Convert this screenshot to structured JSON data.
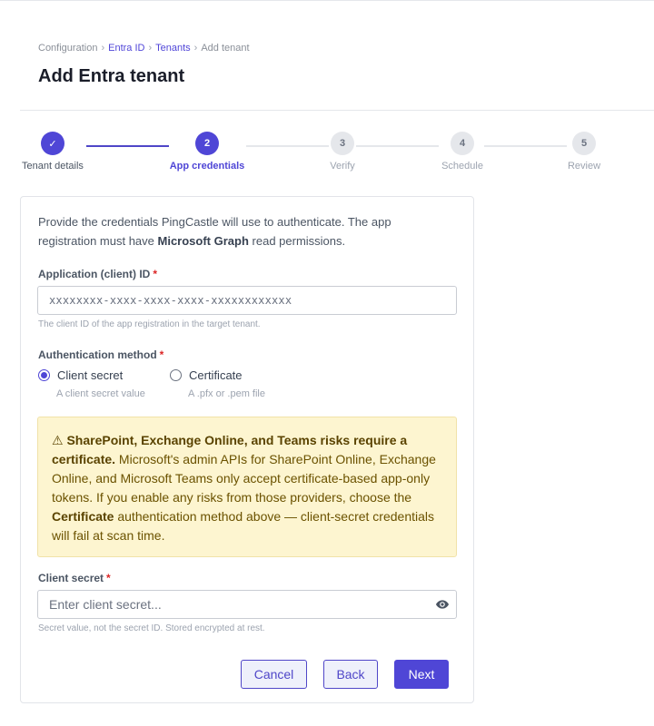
{
  "breadcrumb": {
    "items": [
      "Configuration",
      "Entra ID",
      "Tenants",
      "Add tenant"
    ],
    "separator": "›"
  },
  "page": {
    "title": "Add Entra tenant"
  },
  "stepper": {
    "steps": [
      {
        "number": "✓",
        "label": "Tenant details",
        "state": "done"
      },
      {
        "number": "2",
        "label": "App credentials",
        "state": "active"
      },
      {
        "number": "3",
        "label": "Verify",
        "state": "pending"
      },
      {
        "number": "4",
        "label": "Schedule",
        "state": "pending"
      },
      {
        "number": "5",
        "label": "Review",
        "state": "pending"
      }
    ]
  },
  "form": {
    "intro_part1": "Provide the credentials PingCastle will use to authenticate. The app registration must have ",
    "intro_bold": "Microsoft Graph",
    "intro_part2": " read permissions.",
    "client_id": {
      "label": "Application (client) ID",
      "required_mark": "*",
      "placeholder": "xxxxxxxx-xxxx-xxxx-xxxx-xxxxxxxxxxxx",
      "help": "The client ID of the app registration in the target tenant."
    },
    "auth_method": {
      "label": "Authentication method",
      "required_mark": "*",
      "options": [
        {
          "label": "Client secret",
          "help": "A client secret value",
          "checked": true
        },
        {
          "label": "Certificate",
          "help": "A .pfx or .pem file",
          "checked": false
        }
      ]
    },
    "warning": {
      "icon": "⚠",
      "title": "SharePoint, Exchange Online, and Teams risks require a certificate.",
      "body1": " Microsoft's admin APIs for SharePoint Online, Exchange Online, and Microsoft Teams only accept certificate-based app-only tokens. If you enable any risks from those providers, choose the ",
      "body_bold": "Certificate",
      "body2": " authentication method above — client-secret credentials will fail at scan time."
    },
    "client_secret": {
      "label": "Client secret",
      "required_mark": "*",
      "placeholder": "Enter client secret...",
      "help": "Secret value, not the secret ID. Stored encrypted at rest."
    },
    "buttons": {
      "cancel": "Cancel",
      "back": "Back",
      "next": "Next"
    }
  },
  "colors": {
    "accent": "#4f46d6",
    "warning_bg": "#fdf5d0",
    "required": "#dc2626"
  }
}
